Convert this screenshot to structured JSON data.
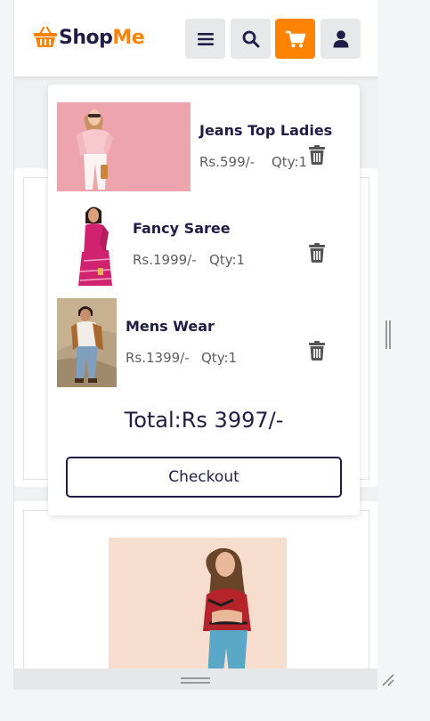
{
  "header": {
    "logo_part1": "Shop",
    "logo_part2": "Me",
    "buttons": [
      "menu-icon",
      "search-icon",
      "cart-icon",
      "user-icon"
    ]
  },
  "colors": {
    "brand_orange": "#ff8300",
    "brand_navy": "#1f1d46",
    "button_gray": "#e7e8ea"
  },
  "cart": {
    "items": [
      {
        "name": "Jeans Top Ladies",
        "price": "Rs.599/-",
        "qty": "Qty:1"
      },
      {
        "name": "Fancy Saree",
        "price": "Rs.1999/-",
        "qty": "Qty:1"
      },
      {
        "name": "Mens Wear",
        "price": "Rs.1399/-",
        "qty": "Qty:1"
      }
    ],
    "total": "Total:Rs 3997/-",
    "checkout_label": "Checkout"
  }
}
